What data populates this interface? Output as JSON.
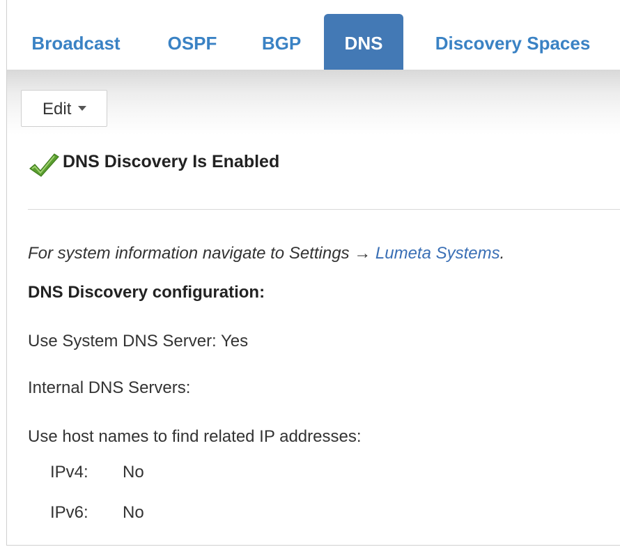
{
  "tabs": [
    {
      "label": "Broadcast",
      "active": false
    },
    {
      "label": "OSPF",
      "active": false
    },
    {
      "label": "BGP",
      "active": false
    },
    {
      "label": "DNS",
      "active": true
    },
    {
      "label": "Discovery Spaces",
      "active": false
    }
  ],
  "toolbar": {
    "edit_label": "Edit"
  },
  "status": {
    "text": "DNS Discovery Is Enabled",
    "icon": "checkmark-icon"
  },
  "info": {
    "prefix": "For system information navigate to Settings → ",
    "link": "Lumeta Systems",
    "suffix": "."
  },
  "config": {
    "title": "DNS Discovery configuration:",
    "use_system_dns_label": "Use System DNS Server:",
    "use_system_dns_value": "Yes",
    "internal_dns_label": "Internal DNS Servers:",
    "host_names_label": "Use host names to find related IP addresses:",
    "ipv4_label": "IPv4:",
    "ipv4_value": "No",
    "ipv6_label": "IPv6:",
    "ipv6_value": "No"
  },
  "colors": {
    "tab_text": "#3a82c4",
    "tab_active_bg": "#4379b5",
    "link": "#3a6fb5",
    "check": "#5a9e2f"
  }
}
